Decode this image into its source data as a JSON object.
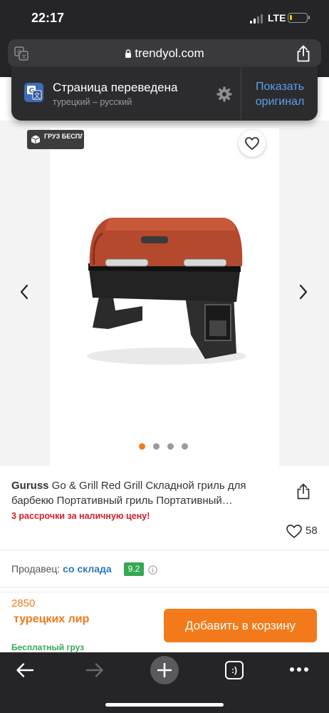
{
  "status_bar": {
    "time": "22:17",
    "network": "LTE",
    "battery_level": 0.15,
    "battery_color": "#f2c40f"
  },
  "browser": {
    "url": "trendyol.com",
    "icons": [
      "translate-icon",
      "lock-icon",
      "share-icon"
    ]
  },
  "translation_banner": {
    "title": "Страница переведена",
    "subtitle": "турецкий – русский",
    "show_original": "Показать оригинал",
    "icons": [
      "translate-icon",
      "gear-icon"
    ]
  },
  "gallery": {
    "badge": "ГРУЗ БЕСПЛАТН",
    "image_count": 4,
    "active_index": 0,
    "icons": [
      "heart-icon",
      "chevron-left-icon",
      "chevron-right-icon",
      "box-icon"
    ]
  },
  "product": {
    "brand": "Guruss",
    "title": " Go & Grill Red Grill Складной гриль для барбекю Портативный гриль Портативный…",
    "installment": "3 рассрочки за наличную цену!",
    "likes": "58"
  },
  "seller": {
    "label": "Продавец: ",
    "name": "со склада",
    "score": "9.2",
    "score_color": "#34a853"
  },
  "buy_bar": {
    "price": "2850",
    "currency": "турецких лир",
    "shipping": "Бесплатный груз",
    "add_to_cart": "Добавить в корзину",
    "accent_color": "#f27a1a"
  },
  "toolbar": {
    "tabs_label": ":)",
    "icons": [
      "arrow-left-icon",
      "arrow-right-icon",
      "plus-icon",
      "tabs-icon",
      "more-icon"
    ]
  }
}
